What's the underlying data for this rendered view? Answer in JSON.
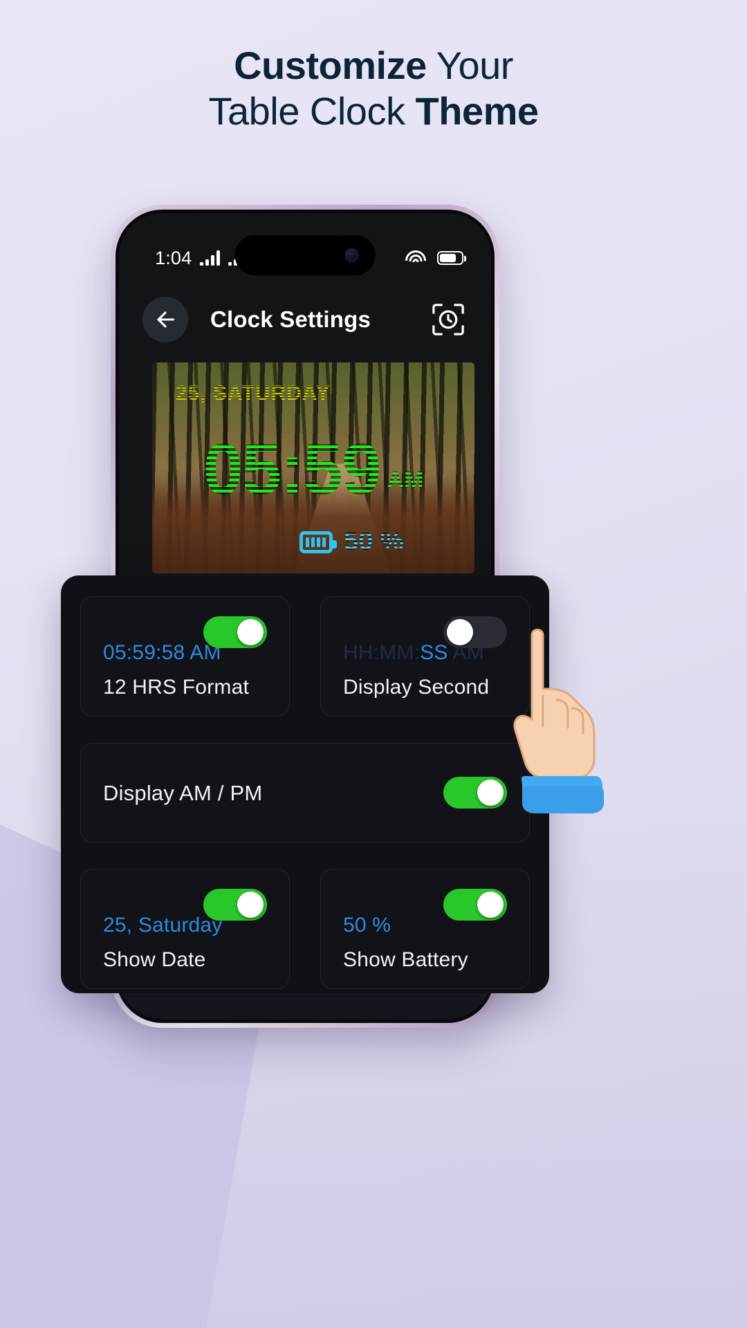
{
  "headline": {
    "line1_bold": "Customize",
    "line1_rest": " Your",
    "line2_rest": "Table Clock ",
    "line2_bold": "Theme"
  },
  "phone": {
    "status_bar": {
      "time": "1:04",
      "signal_icon_1": "signal-bars-icon",
      "signal_icon_2": "signal-bars-icon",
      "wifi_icon": "wifi-icon",
      "battery_icon": "battery-icon"
    },
    "header": {
      "back_icon": "arrow-left-icon",
      "title": "Clock Settings",
      "action_icon": "clock-frame-icon"
    },
    "preview": {
      "date": "25, SATURDAY",
      "time": "05:59",
      "ampm": "AM",
      "battery_icon": "battery-icon",
      "battery_text": "50 %",
      "date_color": "#ecec12",
      "time_color": "#12e712",
      "battery_color": "#2ec4f0"
    }
  },
  "settings": {
    "accent_on": "#28c72a",
    "accent_value": "#2f89de",
    "cards": [
      {
        "name": "hours-format",
        "value": "05:59:58 AM",
        "label": "12 HRS Format",
        "toggle": "on"
      },
      {
        "name": "display-second",
        "value_dim": "HH:MM:",
        "value_bright": "SS ",
        "value_dim2": "AM",
        "label": "Display Second",
        "toggle": "off"
      },
      {
        "name": "display-am-pm",
        "label": "Display AM / PM",
        "toggle": "on"
      },
      {
        "name": "show-date",
        "value": "25, Saturday",
        "label": "Show Date",
        "toggle": "on"
      },
      {
        "name": "show-battery",
        "value": "50 %",
        "label": "Show Battery",
        "toggle": "on"
      }
    ]
  },
  "cursor": {
    "icon": "pointing-hand-icon"
  }
}
